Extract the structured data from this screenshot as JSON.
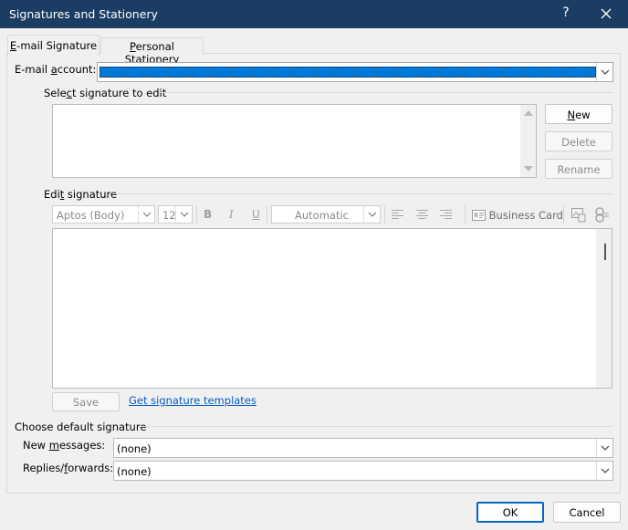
{
  "window": {
    "title": "Signatures and Stationery",
    "help_glyph": "?",
    "close_glyph": "✕"
  },
  "tabs": [
    {
      "label_pre": "",
      "label_mn": "E",
      "label_post": "-mail Signature",
      "active": true
    },
    {
      "label_pre": "",
      "label_mn": "P",
      "label_post": "ersonal Stationery",
      "active": false
    }
  ],
  "email_account": {
    "label_pre": "E-mail ",
    "label_mn": "a",
    "label_post": "ccount:",
    "value": ""
  },
  "select_signature": {
    "label_pre": "Sele",
    "label_mn": "c",
    "label_post": "t signature to edit",
    "buttons": {
      "new_mn": "N",
      "new_rest": "ew",
      "delete": "Delete",
      "rename": "Rename"
    }
  },
  "edit_signature": {
    "label_pre": "Edi",
    "label_mn": "t",
    "label_post": " signature",
    "font": "Aptos (Body)",
    "size": "12",
    "bold": "B",
    "italic": "I",
    "underline": "U",
    "color": "Automatic",
    "business_card": "Business Card",
    "save": "Save",
    "templates_link": "Get signature templates"
  },
  "default_signature": {
    "heading": "Choose default signature",
    "new_messages_pre": "New ",
    "new_messages_mn": "m",
    "new_messages_post": "essages:",
    "new_messages_value": "(none)",
    "replies_pre": "Replies/",
    "replies_mn": "f",
    "replies_post": "orwards:",
    "replies_value": "(none)"
  },
  "footer": {
    "ok": "OK",
    "cancel": "Cancel"
  },
  "colors": {
    "titlebar": "#1c3d63",
    "selection": "#0078d7",
    "link": "#0a5ec2"
  }
}
